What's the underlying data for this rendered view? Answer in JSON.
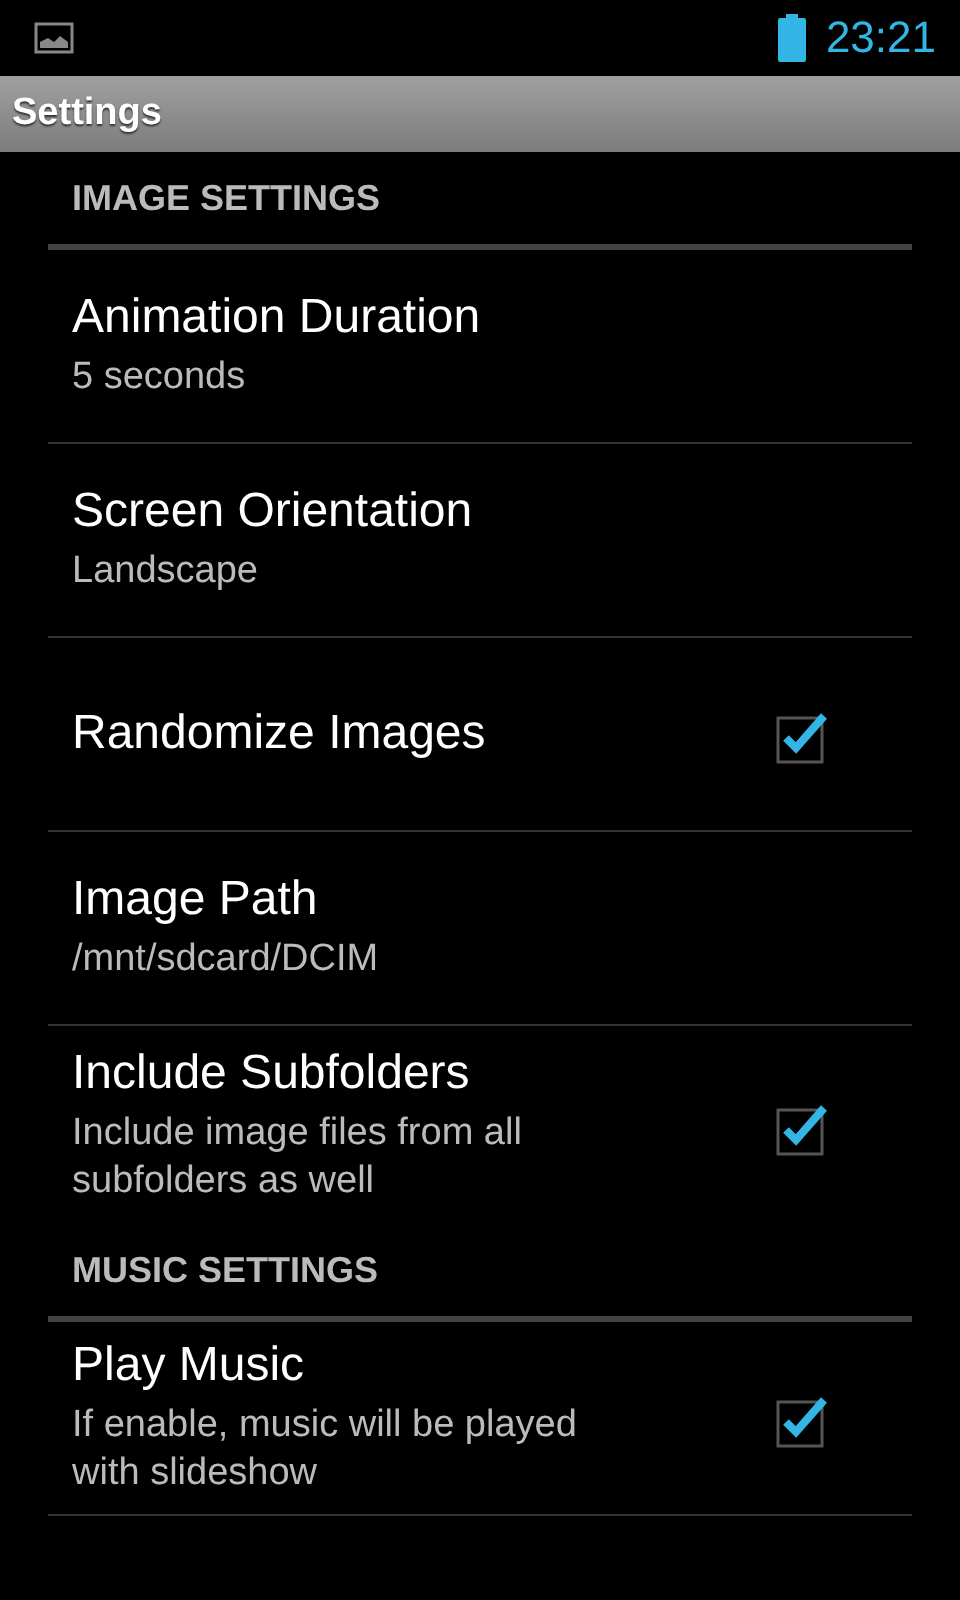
{
  "status_bar": {
    "time": "23:21"
  },
  "title_bar": {
    "title": "Settings"
  },
  "sections": [
    {
      "header": "IMAGE SETTINGS",
      "items": [
        {
          "kind": "text",
          "title": "Animation Duration",
          "summary": "5 seconds"
        },
        {
          "kind": "text",
          "title": "Screen Orientation",
          "summary": "Landscape"
        },
        {
          "kind": "checkbox",
          "title": "Randomize Images",
          "checked": true
        },
        {
          "kind": "text",
          "title": "Image Path",
          "summary": "/mnt/sdcard/DCIM"
        },
        {
          "kind": "checkbox",
          "title": "Include Subfolders",
          "summary": "Include image files from all subfolders as well",
          "checked": true
        }
      ]
    },
    {
      "header": "MUSIC SETTINGS",
      "items": [
        {
          "kind": "checkbox",
          "title": "Play Music",
          "summary": "If enable, music will be played with slideshow",
          "checked": true
        }
      ]
    }
  ]
}
